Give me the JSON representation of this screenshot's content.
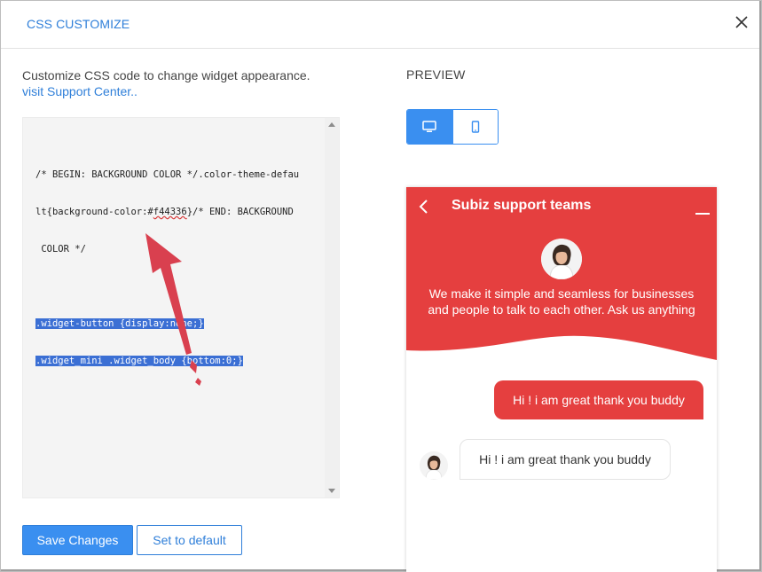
{
  "modal": {
    "title": "CSS CUSTOMIZE",
    "close_icon": "close-icon"
  },
  "editor_section": {
    "description": "Customize CSS code to change widget appearance.",
    "support_link": "visit Support Center.."
  },
  "editor": {
    "lines": [
      "/* BEGIN: BACKGROUND COLOR */.color-theme-defau",
      "lt{background-color:#f44336}/* END: BACKGROUND",
      " COLOR */",
      "",
      ".widget-button {display:none;}",
      ".widget_mini .widget_body {bottom:0;}"
    ]
  },
  "buttons": {
    "save": "Save Changes",
    "reset": "Set to default"
  },
  "preview": {
    "label": "PREVIEW",
    "devices": [
      "desktop-icon",
      "mobile-icon"
    ],
    "selected_device": "desktop"
  },
  "widget": {
    "title": "Subiz support teams",
    "intro": "We make it simple and seamless for businesses and people to talk to each other. Ask us anything",
    "theme_color": "#e53f3f",
    "messages": [
      {
        "from": "visitor",
        "text": "Hi ! i am great thank you buddy"
      },
      {
        "from": "agent",
        "text": "Hi ! i am great thank you buddy"
      }
    ]
  },
  "colors": {
    "accent": "#3a8ff0",
    "link": "#2f7fd9",
    "widget_red": "#e53f3f",
    "selection": "#3b6fd4"
  }
}
